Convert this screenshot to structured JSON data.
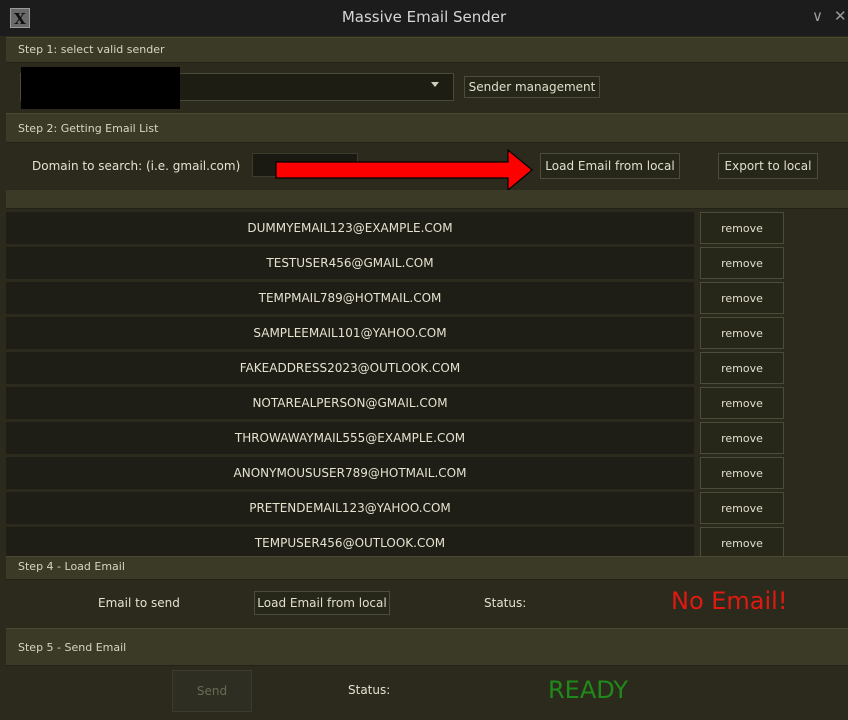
{
  "window": {
    "title": "Massive Email Sender",
    "minimize_glyph": "∨",
    "close_glyph": "✕",
    "icon": "x-app-icon"
  },
  "step1": {
    "label": "Step 1: select valid sender",
    "sender_management_button": "Sender management"
  },
  "step2": {
    "label": "Step 2: Getting Email List",
    "domain_label": "Domain to search: (i.e. gmail.com)",
    "domain_value": "",
    "load_button": "Load Email from local",
    "export_button": "Export to local"
  },
  "emails": [
    {
      "address": "DUMMYEMAIL123@EXAMPLE.COM",
      "remove": "remove"
    },
    {
      "address": "TESTUSER456@GMAIL.COM",
      "remove": "remove"
    },
    {
      "address": "TEMPMAIL789@HOTMAIL.COM",
      "remove": "remove"
    },
    {
      "address": "SAMPLEEMAIL101@YAHOO.COM",
      "remove": "remove"
    },
    {
      "address": "FAKEADDRESS2023@OUTLOOK.COM",
      "remove": "remove"
    },
    {
      "address": "NOTAREALPERSON@GMAIL.COM",
      "remove": "remove"
    },
    {
      "address": "THROWAWAYMAIL555@EXAMPLE.COM",
      "remove": "remove"
    },
    {
      "address": "ANONYMOUSUSER789@HOTMAIL.COM",
      "remove": "remove"
    },
    {
      "address": "PRETENDEMAIL123@YAHOO.COM",
      "remove": "remove"
    },
    {
      "address": "TEMPUSER456@OUTLOOK.COM",
      "remove": "remove"
    }
  ],
  "step4": {
    "label": "Step 4 - Load Email",
    "email_to_send_label": "Email to send",
    "load_button": "Load Email from local",
    "status_label": "Status:",
    "status_value": "No Email!",
    "status_color": "#e01a12"
  },
  "step5": {
    "label": "Step 5 - Send Email",
    "send_button": "Send",
    "status_label": "Status:",
    "status_value": "READY",
    "status_color": "#1f8a1a"
  },
  "annotation": {
    "arrow_color": "#ff0000",
    "icon": "red-arrow-icon"
  }
}
